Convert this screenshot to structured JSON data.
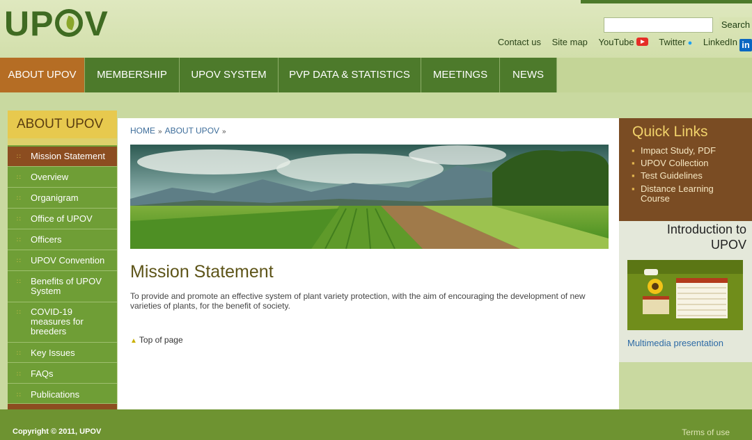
{
  "header": {
    "logo_text": "UPOV",
    "search": {
      "placeholder": "",
      "value": "",
      "button_label": "Search"
    },
    "links": [
      {
        "label": "Contact us"
      },
      {
        "label": "Site map"
      },
      {
        "label": "YouTube",
        "icon": "youtube-icon"
      },
      {
        "label": "Twitter",
        "icon": "twitter-icon"
      },
      {
        "label": "LinkedIn",
        "icon": "linkedin-icon"
      }
    ]
  },
  "nav": {
    "items": [
      {
        "label": "ABOUT UPOV",
        "active": true
      },
      {
        "label": "MEMBERSHIP"
      },
      {
        "label": "UPOV SYSTEM"
      },
      {
        "label": "PVP DATA & STATISTICS"
      },
      {
        "label": "MEETINGS"
      },
      {
        "label": "NEWS"
      }
    ]
  },
  "sidebar": {
    "heading": "ABOUT UPOV",
    "items": [
      {
        "label": "Mission Statement",
        "active": true
      },
      {
        "label": "Overview"
      },
      {
        "label": "Organigram"
      },
      {
        "label": "Office of UPOV"
      },
      {
        "label": "Officers"
      },
      {
        "label": "UPOV Convention"
      },
      {
        "label": "Benefits of UPOV System"
      },
      {
        "label": "COVID-19 measures for breeders"
      },
      {
        "label": "Key Issues"
      },
      {
        "label": "FAQs"
      },
      {
        "label": "Publications"
      }
    ]
  },
  "breadcrumb": [
    "HOME",
    "ABOUT UPOV"
  ],
  "main": {
    "title": "Mission Statement",
    "text": "To provide and promote an effective system of plant variety protection, with the aim of encouraging the development of new varieties of plants, for the benefit of society.",
    "top_link": "Top of page"
  },
  "quick_links": {
    "title": "Quick Links",
    "items": [
      "Impact Study, PDF",
      "UPOV Collection",
      "Test Guidelines",
      "Distance Learning Course"
    ]
  },
  "intro": {
    "title": "Introduction to UPOV",
    "link": "Multimedia presentation"
  },
  "footer": {
    "copyright": "Copyright © 2011, UPOV",
    "terms": "Terms of use"
  },
  "colors": {
    "nav_green": "#4d7a2b",
    "accent_orange": "#b56d24",
    "sidebar_green": "#6f9e36",
    "quick_links_brown": "#7a4c23"
  }
}
